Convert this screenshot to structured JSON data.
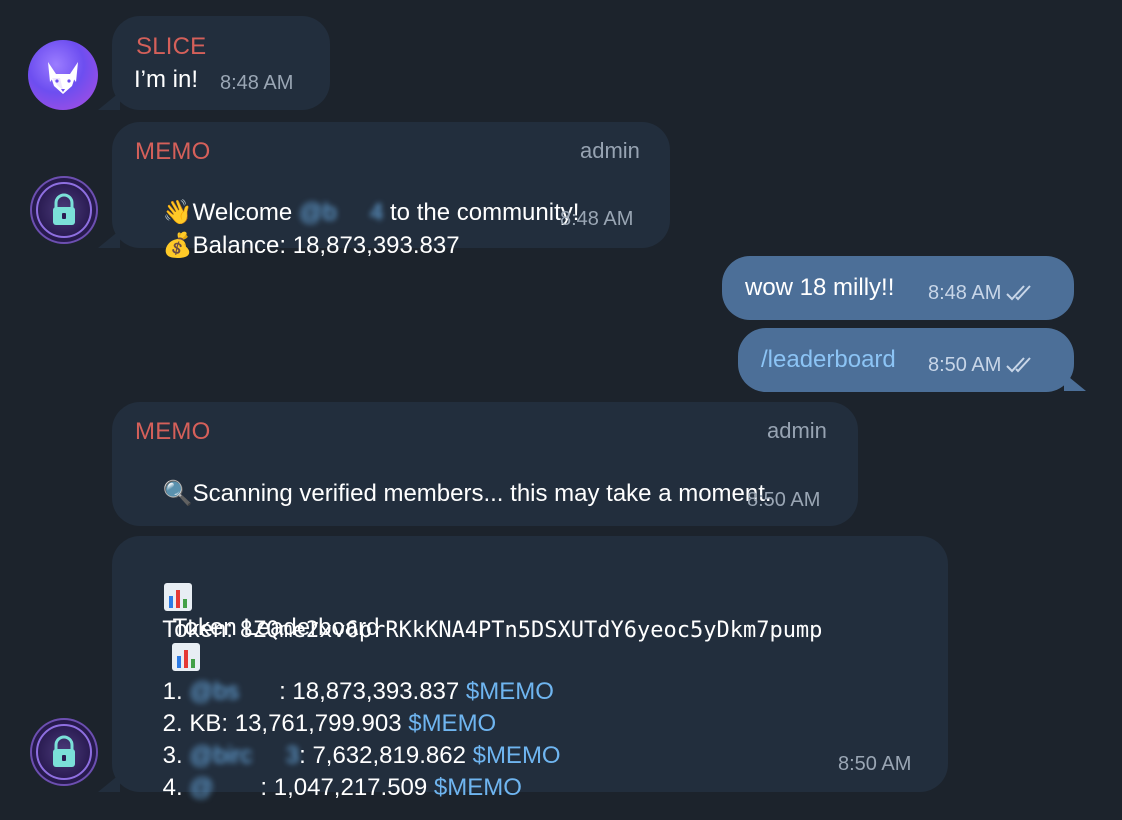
{
  "messages": {
    "m1": {
      "sender": "SLICE",
      "text": "I’m in!",
      "time": "8:48 AM"
    },
    "m2": {
      "sender": "MEMO",
      "role": "admin",
      "line1_pre": "Welcome ",
      "line1_mention": "@b     4",
      "line1_post": " to the community!",
      "line2": "Balance: 18,873,393.837",
      "time": "8:48 AM",
      "emoji1": "wave",
      "emoji2": "money-bag"
    },
    "m3": {
      "text": "wow 18 milly!!",
      "time": "8:48 AM"
    },
    "m4": {
      "text": "/leaderboard",
      "time": "8:50 AM"
    },
    "m5": {
      "sender": "MEMO",
      "role": "admin",
      "text": "Scanning verified members... this may take a moment.",
      "time": "8:50 AM",
      "emoji": "magnifier"
    },
    "m6": {
      "title": "Token Leaderboard",
      "token_label": "Token:",
      "token_address": "8ZQme2xv6prRKkKNA4PTn5DSXUTdY6yeoc5yDkm7pump",
      "ticker": "$MEMO",
      "rows": [
        {
          "rank": "1.",
          "name": "@bs      ",
          "sep": ":",
          "amount": "18,873,393.837",
          "hidden": true
        },
        {
          "rank": "2.",
          "name": "KB",
          "sep": ":",
          "amount": "13,761,799.903",
          "hidden": false
        },
        {
          "rank": "3.",
          "name": "@birc     3",
          "sep": ":",
          "amount": "7,632,819.862",
          "hidden": true
        },
        {
          "rank": "4.",
          "name": "@       ",
          "sep": ":",
          "amount": "1,047,217.509",
          "hidden": true
        }
      ],
      "time": "8:50 AM"
    }
  },
  "colors": {
    "background": "#1c232c",
    "incoming_bubble": "#222e3d",
    "outgoing_bubble": "#4c6f98",
    "sender_name": "#d5605a",
    "link": "#6fb5f0"
  }
}
